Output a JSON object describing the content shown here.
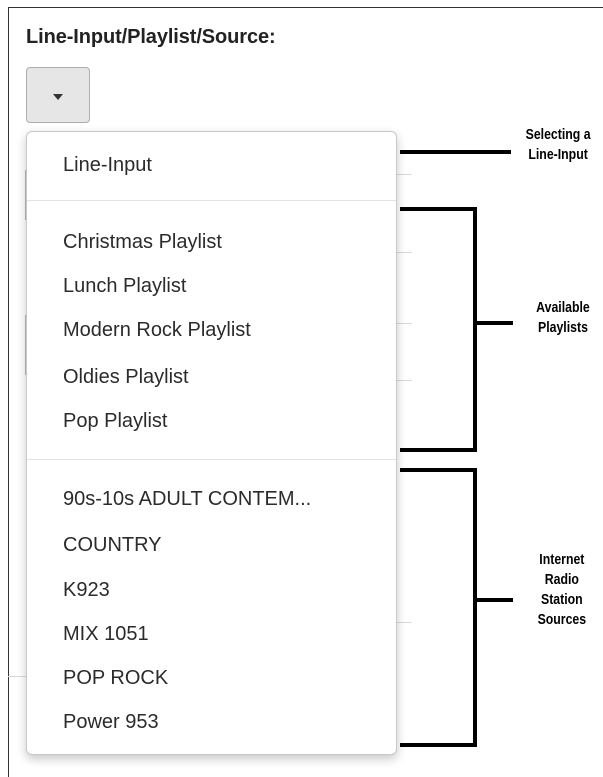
{
  "section_label": "Line-Input/Playlist/Source:",
  "dropdown": {
    "caret_icon": "caret-down-icon"
  },
  "menu": {
    "line_input": [
      "Line-Input"
    ],
    "playlists": [
      "Christmas Playlist",
      "Lunch Playlist",
      "Modern Rock Playlist",
      "Oldies Playlist",
      "Pop Playlist"
    ],
    "radio_sources": [
      "90s-10s ADULT CONTEM...",
      "COUNTRY",
      "K923",
      "MIX 1051",
      "POP ROCK",
      "Power 953"
    ]
  },
  "annotations": {
    "line_input": [
      "Selecting a",
      "Line-Input"
    ],
    "playlists": [
      "Available",
      "Playlists"
    ],
    "radio": [
      "Internet",
      "Radio",
      "Station",
      "Sources"
    ]
  }
}
